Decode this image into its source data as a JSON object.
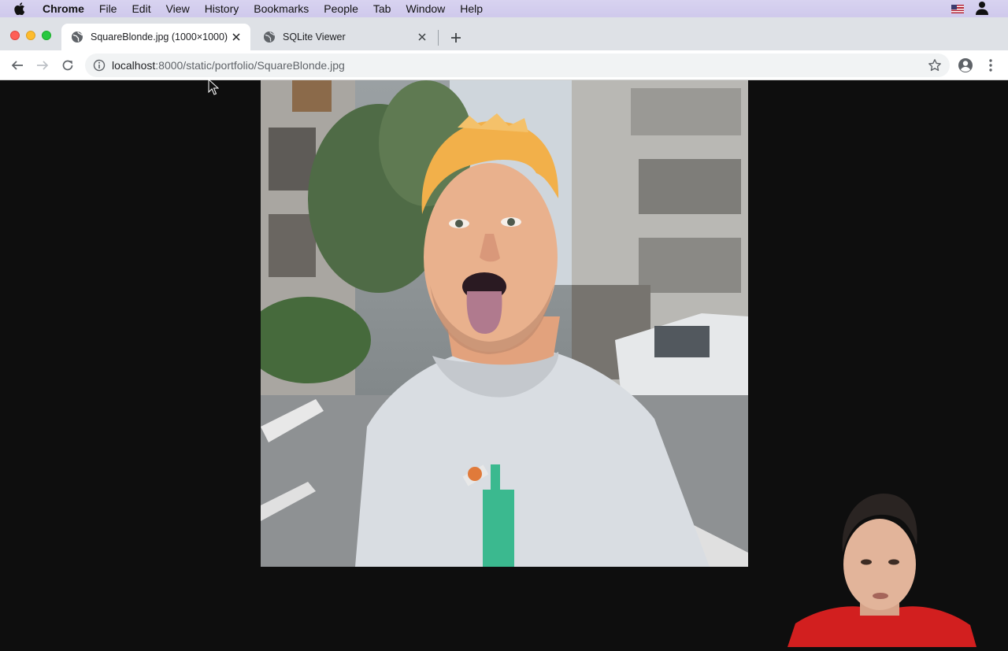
{
  "menubar": {
    "app_name": "Chrome",
    "items": [
      "File",
      "Edit",
      "View",
      "History",
      "Bookmarks",
      "People",
      "Tab",
      "Window",
      "Help"
    ]
  },
  "tabs": [
    {
      "title": "SquareBlonde.jpg (1000×1000)",
      "active": true
    },
    {
      "title": "SQLite Viewer",
      "active": false
    }
  ],
  "omnibox": {
    "url_host": "localhost",
    "url_path": ":8000/static/portfolio/SquareBlonde.jpg"
  },
  "colors": {
    "menubar_bg": "#d8d3f0",
    "tabstrip_bg": "#dee1e6",
    "viewer_bg": "#0e0e0e",
    "hair": "#f2b04a",
    "shirt": "#d9dde2",
    "webcam_shirt": "#d21f1f"
  },
  "icons": {
    "apple": "apple-icon",
    "back": "back-arrow-icon",
    "forward": "forward-arrow-icon",
    "reload": "reload-icon",
    "info": "info-icon",
    "bookmark": "star-icon",
    "profile": "profile-icon",
    "menu": "kebab-menu-icon"
  }
}
